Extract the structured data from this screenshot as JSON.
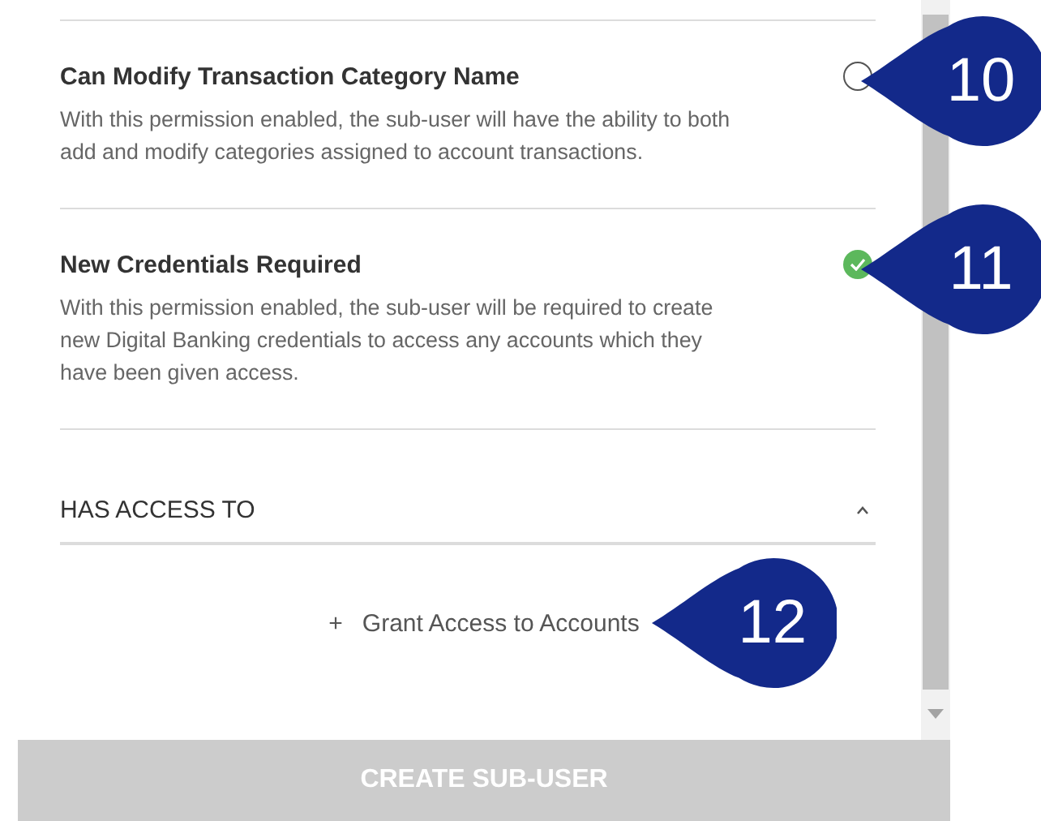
{
  "permissions": [
    {
      "title": "Can Modify Transaction Category Name",
      "description": "With this permission enabled, the sub-user will have the ability to both add and modify categories assigned to account transactions.",
      "enabled": false,
      "callout": "10"
    },
    {
      "title": "New Credentials Required",
      "description": "With this permission enabled, the sub-user will be required to create new Digital Banking credentials to access any accounts which they have been given access.",
      "enabled": true,
      "callout": "11"
    }
  ],
  "access_section": {
    "title": "HAS ACCESS TO",
    "expanded": true,
    "grant_link": {
      "icon": "+",
      "label": "Grant Access to Accounts",
      "callout": "12"
    }
  },
  "create_button": {
    "label": "CREATE SUB-USER",
    "disabled": true
  }
}
